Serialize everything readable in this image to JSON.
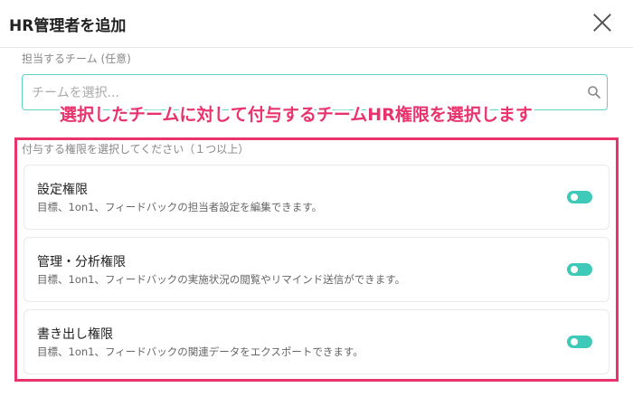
{
  "dialog": {
    "title": "HR管理者を追加",
    "close_icon": "close-icon"
  },
  "team_field": {
    "label": "担当するチーム (任意)",
    "placeholder": "チームを選択...",
    "value": "",
    "icon": "search-icon"
  },
  "annotation": {
    "text": "選択したチームに対して付与するチームHR権限を選択します",
    "color": "#e8336d"
  },
  "permissions": {
    "section_label": "付与する権限を選択してください（１つ以上）",
    "items": [
      {
        "title": "設定権限",
        "description": "目標、1on1、フィードバックの担当者設定を編集できます。",
        "enabled": true
      },
      {
        "title": "管理・分析権限",
        "description": "目標、1on1、フィードバックの実施状況の閲覧やリマインド送信ができます。",
        "enabled": true
      },
      {
        "title": "書き出し権限",
        "description": "目標、1on1、フィードバックの関連データをエクスポートできます。",
        "enabled": true
      }
    ],
    "toggle_color": "#3ec9b8"
  }
}
